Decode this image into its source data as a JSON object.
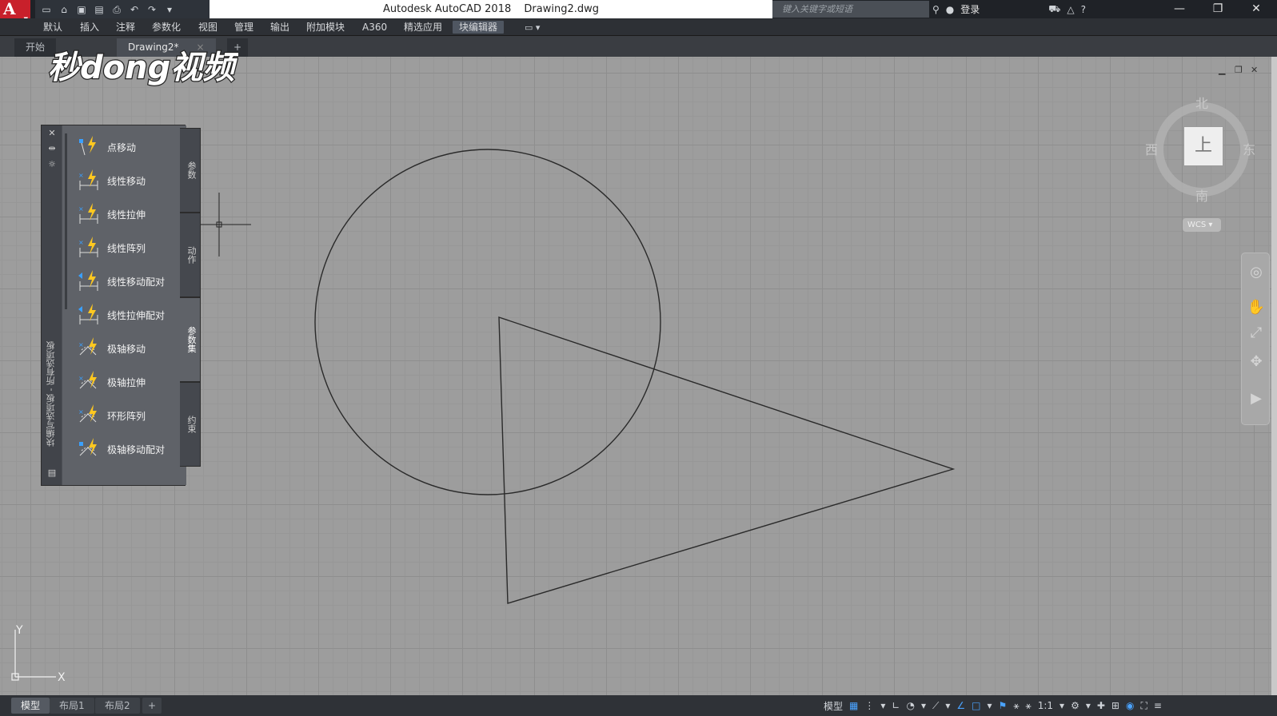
{
  "window": {
    "app_name": "Autodesk AutoCAD 2018",
    "file_name": "Drawing2.dwg",
    "search_placeholder": "键入关键字或短语",
    "login_label": "登录",
    "minimize": "—",
    "restore": "❐",
    "close": "✕"
  },
  "menu": {
    "items": [
      "默认",
      "插入",
      "注释",
      "参数化",
      "视图",
      "管理",
      "输出",
      "附加模块",
      "A360",
      "精选应用",
      "块编辑器"
    ],
    "active_index": 10
  },
  "doc_tabs": {
    "start": "开始",
    "current": "Drawing2*",
    "close": "×",
    "add": "+"
  },
  "watermark": {
    "text": "秒dong视频"
  },
  "palette": {
    "title": "块编写选项板 - 所有选项板",
    "items": [
      "点移动",
      "线性移动",
      "线性拉伸",
      "线性阵列",
      "线性移动配对",
      "线性拉伸配对",
      "极轴移动",
      "极轴拉伸",
      "环形阵列",
      "极轴移动配对"
    ],
    "tabs": [
      "参数",
      "动作",
      "参数集",
      "约束"
    ],
    "active_tab": 2
  },
  "viewcube": {
    "face": "上",
    "north": "北",
    "south": "南",
    "east": "东",
    "west": "西",
    "wcs": "WCS"
  },
  "ucs": {
    "x": "X",
    "y": "Y"
  },
  "status": {
    "layouts": [
      "模型",
      "布局1",
      "布局2"
    ],
    "active_layout": 0,
    "add": "+",
    "model_label": "模型",
    "scale": "1:1"
  },
  "colors": {
    "canvas": "#9d9d9d",
    "accent": "#4aa3ff",
    "logo_red": "#c8202b",
    "geometry_stroke": "#2a2a2a"
  }
}
